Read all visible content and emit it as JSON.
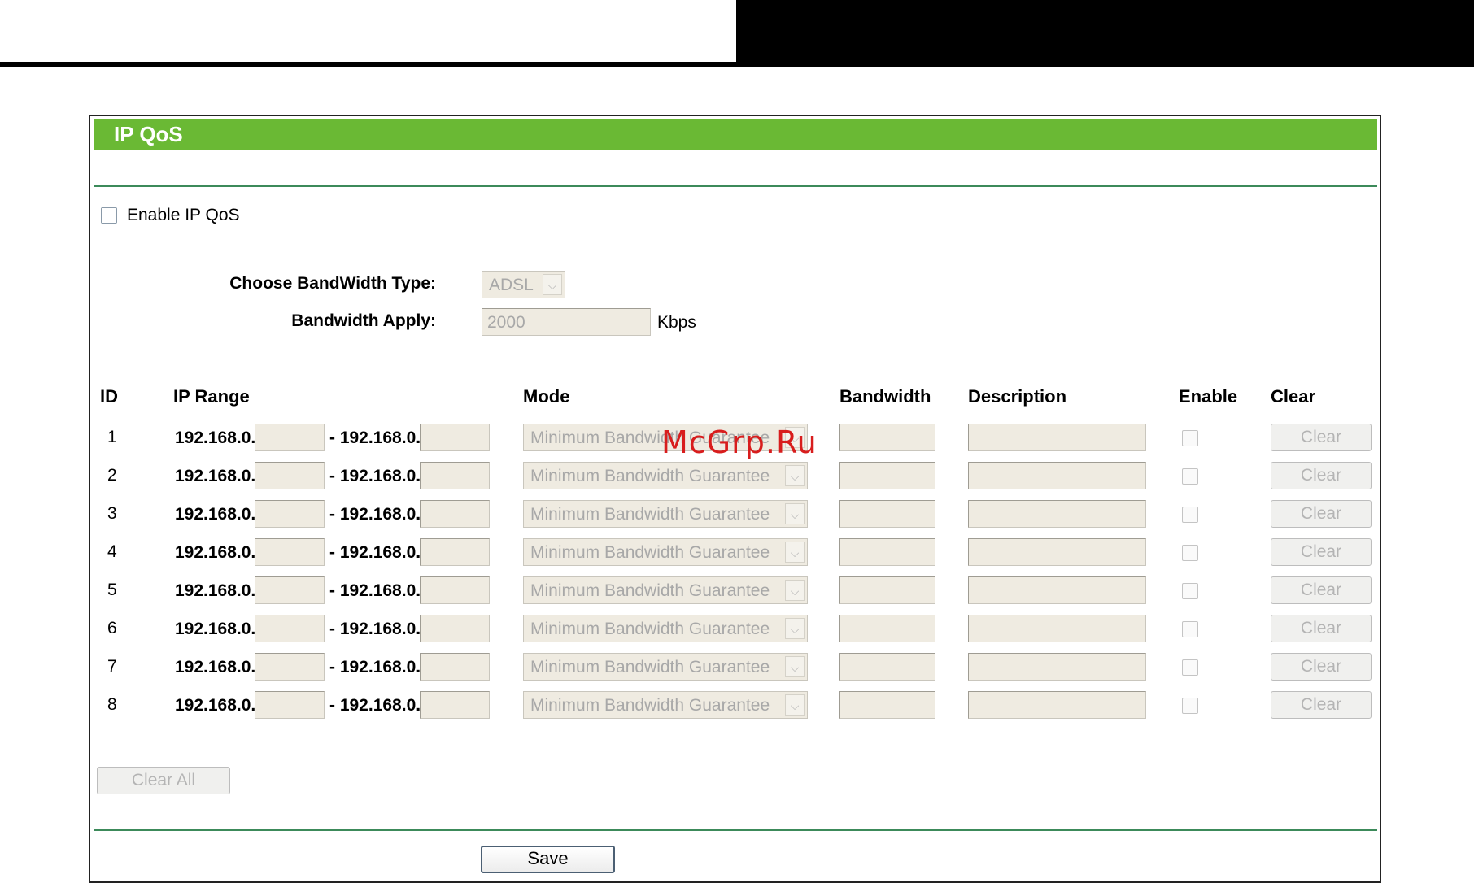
{
  "page": {
    "title": "IP QoS",
    "enable_label": "Enable IP QoS",
    "bandwidth_type_label": "Choose BandWidth Type:",
    "bandwidth_type_value": "ADSL",
    "bandwidth_apply_label": "Bandwidth Apply:",
    "bandwidth_apply_value": "2000",
    "bandwidth_unit": "Kbps",
    "clear_all_label": "Clear All",
    "save_label": "Save",
    "watermark": "McGrp.Ru"
  },
  "table": {
    "headers": {
      "id": "ID",
      "ip_range": "IP Range",
      "mode": "Mode",
      "bandwidth": "Bandwidth",
      "description": "Description",
      "enable": "Enable",
      "clear": "Clear"
    },
    "ip_prefix": "192.168.0.",
    "range_sep": "- 192.168.0.",
    "rows": [
      {
        "id": "1",
        "mode": "Minimum Bandwidth Guarantee",
        "clear": "Clear"
      },
      {
        "id": "2",
        "mode": "Minimum Bandwidth Guarantee",
        "clear": "Clear"
      },
      {
        "id": "3",
        "mode": "Minimum Bandwidth Guarantee",
        "clear": "Clear"
      },
      {
        "id": "4",
        "mode": "Minimum Bandwidth Guarantee",
        "clear": "Clear"
      },
      {
        "id": "5",
        "mode": "Minimum Bandwidth Guarantee",
        "clear": "Clear"
      },
      {
        "id": "6",
        "mode": "Minimum Bandwidth Guarantee",
        "clear": "Clear"
      },
      {
        "id": "7",
        "mode": "Minimum Bandwidth Guarantee",
        "clear": "Clear"
      },
      {
        "id": "8",
        "mode": "Minimum Bandwidth Guarantee",
        "clear": "Clear"
      }
    ]
  },
  "colors": {
    "header_green": "#6ab934",
    "divider_green": "#3c8a5a",
    "watermark_red": "#d81d1d"
  }
}
